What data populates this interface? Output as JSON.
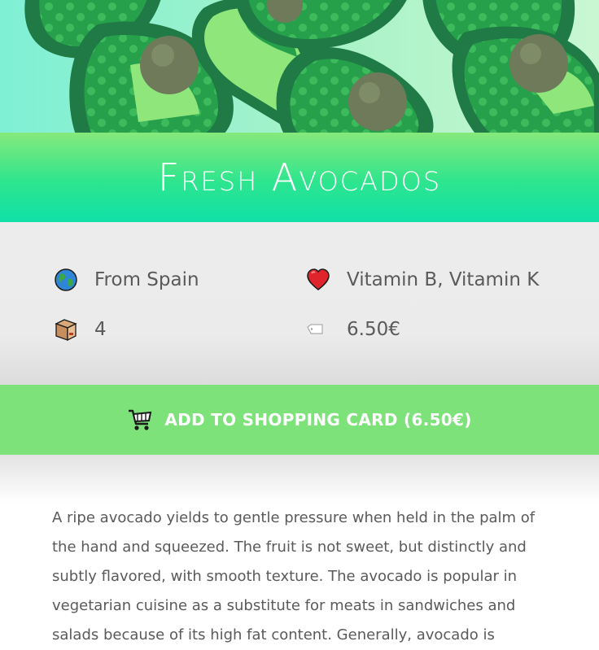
{
  "product": {
    "title": "Fresh Avocados"
  },
  "facts": {
    "origin": {
      "icon": "globe-icon",
      "text": "From Spain"
    },
    "vitamins": {
      "icon": "heart-icon",
      "text": "Vitamin B, Vitamin K"
    },
    "quantity": {
      "icon": "package-icon",
      "text": "4"
    },
    "price": {
      "icon": "price-tag-icon",
      "text": "6.50€"
    }
  },
  "cart": {
    "icon": "shopping-cart-icon",
    "label": "ADD TO SHOPPING CARD (6.50€)"
  },
  "description": {
    "text": "A ripe avocado yields to gentle pressure when held in the palm of the hand and squeezed. The fruit is not sweet, but distinctly and subtly flavored, with smooth texture. The avocado is popular in vegetarian cuisine as a substitute for meats in sandwiches and salads because of its high fat content. Generally, avocado is served"
  },
  "colors": {
    "title_band_top": "#86e97b",
    "title_band_bottom": "#0fe0a8",
    "button": "#7de27a",
    "facts_bg": "#ececec",
    "text": "#5a5a5a"
  }
}
